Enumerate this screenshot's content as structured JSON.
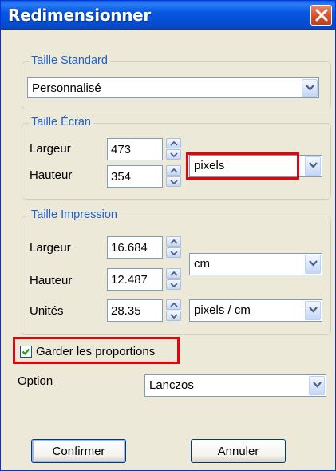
{
  "window": {
    "title": "Redimensionner"
  },
  "standard_size": {
    "legend": "Taille Standard",
    "selected": "Personnalisé"
  },
  "screen_size": {
    "legend": "Taille Écran",
    "width_label": "Largeur",
    "width_value": "473",
    "height_label": "Hauteur",
    "height_value": "354",
    "unit_selected": "pixels"
  },
  "print_size": {
    "legend": "Taille Impression",
    "width_label": "Largeur",
    "width_value": "16.684",
    "height_label": "Hauteur",
    "height_value": "12.487",
    "unit_selected": "cm",
    "units_label": "Unités",
    "units_value": "28.35",
    "units_selected": "pixels / cm"
  },
  "keep_proportions": {
    "label": "Garder les proportions",
    "checked": true
  },
  "option": {
    "label": "Option",
    "selected": "Lanczos"
  },
  "buttons": {
    "confirm": "Confirmer",
    "cancel": "Annuler"
  },
  "colors": {
    "highlight": "#e8000a",
    "group_label": "#1f5fcf",
    "titlebar": "#0550d6"
  },
  "icons": {
    "close": "close-icon",
    "dropdown": "chevron-down-icon",
    "spin_up": "spin-up-icon",
    "spin_down": "spin-down-icon",
    "check": "checkmark-icon"
  }
}
